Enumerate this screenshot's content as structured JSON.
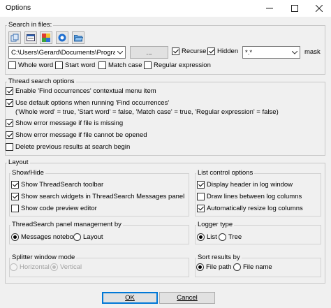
{
  "window": {
    "title": "Options",
    "icons": [
      "minimize-icon",
      "maximize-icon",
      "close-icon"
    ]
  },
  "search_in_files": {
    "label": "Search in files:",
    "toolbar_icons": [
      "open-files-icon",
      "project-files-icon",
      "workspace-files-icon",
      "directory-icon",
      "folder-open-icon"
    ],
    "path_value": "C:\\Users\\Gerard\\Documents\\Programr",
    "browse_label": "...",
    "recurse_label": "Recurse",
    "recurse_checked": true,
    "hidden_label": "Hidden",
    "hidden_checked": true,
    "mask_value": "*.*",
    "mask_label": "mask",
    "options": [
      {
        "label": "Whole word",
        "checked": false
      },
      {
        "label": "Start word",
        "checked": false
      },
      {
        "label": "Match case",
        "checked": false
      },
      {
        "label": "Regular expression",
        "checked": false
      }
    ]
  },
  "threadsearch_options": {
    "label": "Thread search options",
    "items": [
      {
        "label": "Enable 'Find occurrences' contextual menu item",
        "checked": true
      },
      {
        "label": "Use default options when running 'Find occurrences'",
        "checked": true
      },
      {
        "label": "Show error message if file is missing",
        "checked": true
      },
      {
        "label": "Show error message if file cannot be opened",
        "checked": true
      },
      {
        "label": "Delete previous results at search begin",
        "checked": false
      }
    ],
    "default_options_note": "('Whole word' = true, 'Start word' = false, 'Match case' = true, 'Regular expression' = false)"
  },
  "layout": {
    "label": "Layout",
    "show_hide": {
      "label": "Show/Hide",
      "items": [
        {
          "label": "Show ThreadSearch toolbar",
          "checked": true
        },
        {
          "label": "Show search widgets in ThreadSearch Messages panel",
          "checked": true
        },
        {
          "label": "Show code preview editor",
          "checked": false
        }
      ]
    },
    "list_control": {
      "label": "List control options",
      "items": [
        {
          "label": "Display header in log window",
          "checked": true
        },
        {
          "label": "Draw lines between log columns",
          "checked": false
        },
        {
          "label": "Automatically resize log columns",
          "checked": true
        }
      ]
    },
    "panel_management": {
      "label": "ThreadSearch panel management by",
      "options": [
        {
          "label": "Messages notebook",
          "selected": true
        },
        {
          "label": "Layout",
          "selected": false
        }
      ]
    },
    "logger_type": {
      "label": "Logger type",
      "options": [
        {
          "label": "List",
          "selected": true
        },
        {
          "label": "Tree",
          "selected": false
        }
      ]
    },
    "splitter_mode": {
      "label": "Splitter window mode",
      "options": [
        {
          "label": "Horizontal",
          "selected": false
        },
        {
          "label": "Vertical",
          "selected": true
        }
      ]
    },
    "sort_results": {
      "label": "Sort results by",
      "options": [
        {
          "label": "File path",
          "selected": true
        },
        {
          "label": "File name",
          "selected": false
        }
      ]
    }
  },
  "footer": {
    "ok_label": "OK",
    "cancel_label": "Cancel"
  }
}
